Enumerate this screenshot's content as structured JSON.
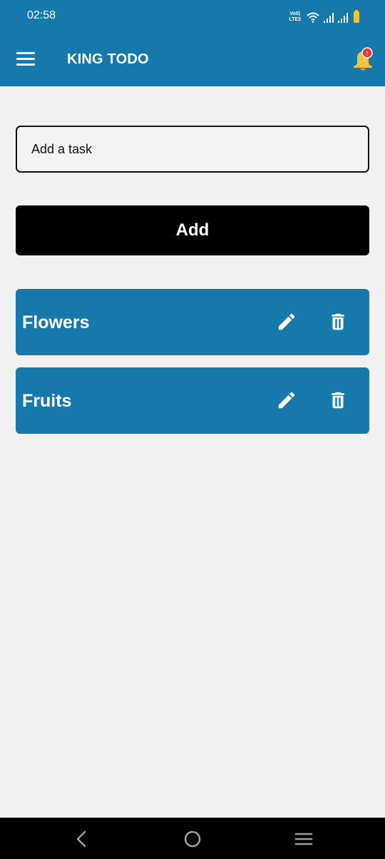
{
  "status_bar": {
    "time": "02:58",
    "volte_line1": "Vo0)",
    "volte_line2": "LTE2",
    "battery_color": "#f5c518"
  },
  "app_bar": {
    "title": "KING TODO",
    "color": "#1778ab",
    "menu_icon": "hamburger-menu-icon",
    "notification_icon": "bell-icon",
    "notification_badge": "!"
  },
  "task_input": {
    "placeholder": "Add a task",
    "value": ""
  },
  "add_button": {
    "label": "Add"
  },
  "tasks": [
    {
      "title": "Flowers",
      "edit_icon": "pencil-icon",
      "delete_icon": "trash-icon"
    },
    {
      "title": "Fruits",
      "edit_icon": "pencil-icon",
      "delete_icon": "trash-icon"
    }
  ],
  "nav_bar": {
    "back_icon": "back-chevron-icon",
    "home_icon": "home-circle-icon",
    "recents_icon": "recents-lines-icon"
  }
}
